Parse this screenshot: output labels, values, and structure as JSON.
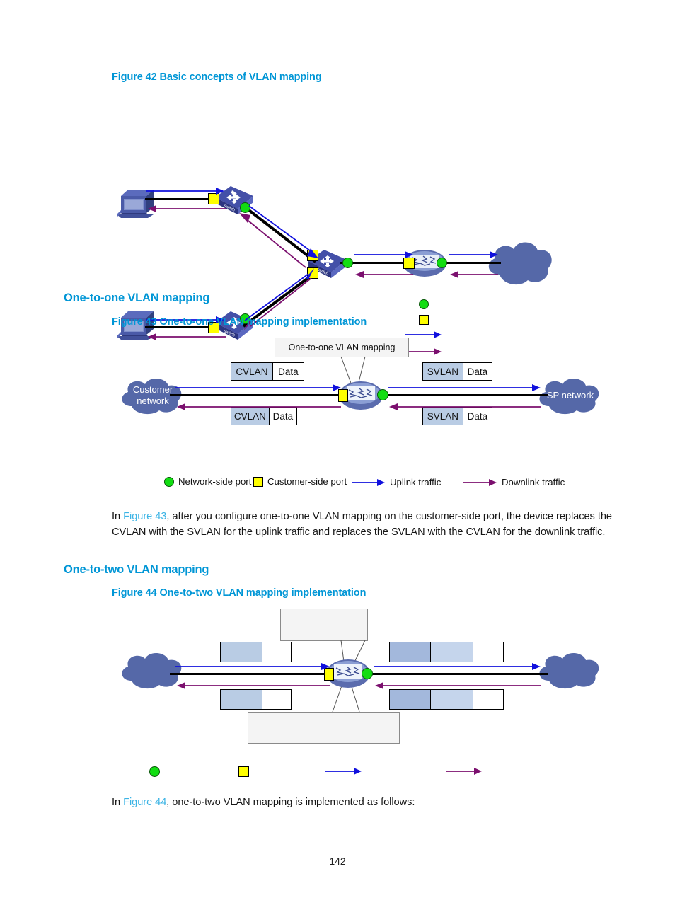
{
  "page": {
    "number": "142"
  },
  "figure42": {
    "caption": "Figure 42 Basic concepts of VLAN mapping",
    "legend": {
      "network_side_port": "",
      "customer_side_port": "",
      "uplink_traffic": "",
      "downlink_traffic": ""
    },
    "nodes": {
      "pc_top": "",
      "pc_bottom": "",
      "switch_top": "",
      "switch_bottom": "",
      "switch_center": "",
      "router": "",
      "cloud": ""
    }
  },
  "section_one_to_one": {
    "heading": "One-to-one VLAN mapping"
  },
  "figure43": {
    "caption": "Figure 43 One-to-one VLAN mapping implementation",
    "callout": "One-to-one VLAN mapping",
    "cloud_left": "Customer\nnetwork",
    "cloud_left_line1": "Customer",
    "cloud_left_line2": "network",
    "cloud_right": "SP network",
    "frames": {
      "top_left_tag": "CVLAN",
      "top_left_data": "Data",
      "bottom_left_tag": "CVLAN",
      "bottom_left_data": "Data",
      "top_right_tag": "SVLAN",
      "top_right_data": "Data",
      "bottom_right_tag": "SVLAN",
      "bottom_right_data": "Data"
    },
    "legend": {
      "network_side_port": "Network-side port",
      "customer_side_port": "Customer-side port",
      "uplink_traffic": "Uplink traffic",
      "downlink_traffic": "Downlink traffic"
    }
  },
  "paragraph43": {
    "pre": "In ",
    "link": "Figure 43",
    "post": ", after you configure one-to-one VLAN mapping on the customer-side port, the device replaces the CVLAN with the SVLAN for the uplink traffic and replaces the SVLAN with the CVLAN for the downlink traffic."
  },
  "section_one_to_two": {
    "heading": "One-to-two VLAN mapping"
  },
  "figure44": {
    "caption": "Figure 44 One-to-two VLAN mapping implementation",
    "callout_top": "",
    "callout_bottom": "",
    "cloud_left": "",
    "cloud_right": "",
    "frames": {
      "top_left_tag": "",
      "top_left_data": "",
      "bottom_left_tag": "",
      "bottom_left_data": "",
      "top_right_tag1": "",
      "top_right_tag2": "",
      "top_right_data": "",
      "bottom_right_tag1": "",
      "bottom_right_tag2": "",
      "bottom_right_data": ""
    },
    "legend": {
      "network_side_port": "",
      "customer_side_port": "",
      "uplink_traffic": "",
      "downlink_traffic": ""
    }
  },
  "paragraph44": {
    "pre": "In ",
    "link": "Figure 44",
    "post": ", one-to-two VLAN mapping is implemented as follows:"
  },
  "colors": {
    "heading": "#0096d6",
    "link": "#3cb4e5",
    "cloud": "#5568a8",
    "device_blue": "#3d4a9e",
    "port_green": "#12dd12",
    "port_yellow": "#ffff00",
    "uplink_arrow": "#1010dd",
    "downlink_arrow": "#7b0f6e",
    "tag_fill": "#b9cce4"
  }
}
